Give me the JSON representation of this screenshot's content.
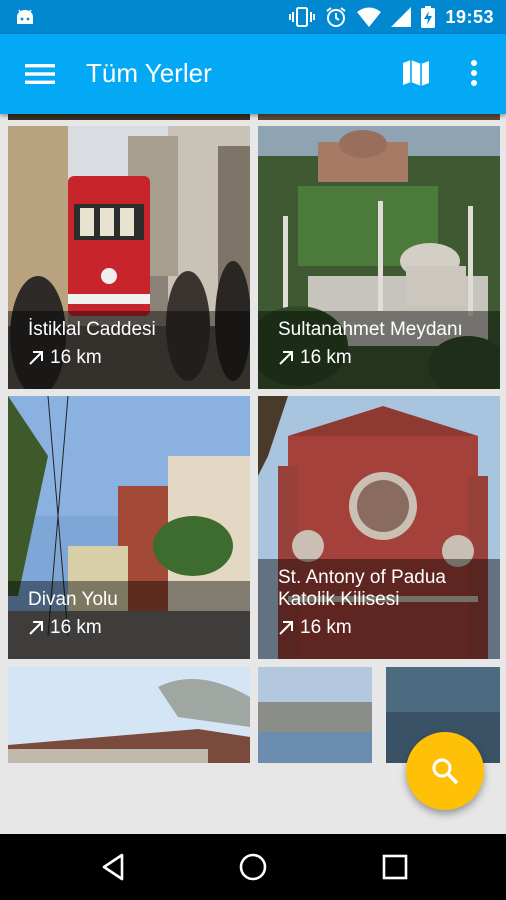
{
  "status_bar": {
    "time": "19:53"
  },
  "app_bar": {
    "title": "Tüm Yerler"
  },
  "places": [
    {
      "name": "İstiklal Caddesi",
      "distance": "16 km"
    },
    {
      "name": "Sultanahmet Meydanı",
      "distance": "16 km"
    },
    {
      "name": "Divan Yolu",
      "distance": "16 km"
    },
    {
      "name": "St. Antony of Padua Katolik Kilisesi",
      "distance": "16 km"
    }
  ],
  "colors": {
    "status_bar": "#0288d1",
    "app_bar": "#03a9f4",
    "fab": "#ffc107"
  },
  "icons": {
    "menu": "menu-icon",
    "map": "map-icon",
    "more": "more-vert-icon",
    "distance": "arrow-up-right-icon",
    "fab": "search-icon",
    "back": "back-icon",
    "home": "home-icon",
    "recents": "recents-icon"
  }
}
